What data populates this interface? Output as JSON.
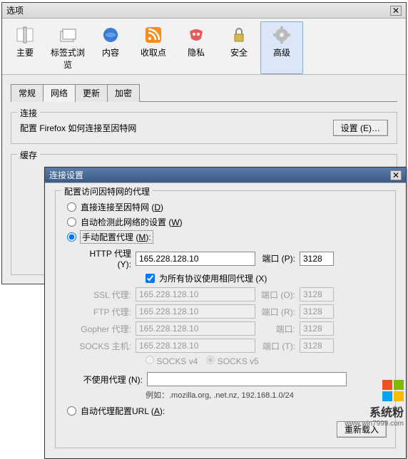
{
  "window": {
    "title": "选项",
    "toolbar": [
      {
        "label": "主要",
        "name": "main"
      },
      {
        "label": "标签式浏览",
        "name": "tabs"
      },
      {
        "label": "内容",
        "name": "content"
      },
      {
        "label": "收取点",
        "name": "feeds"
      },
      {
        "label": "隐私",
        "name": "privacy"
      },
      {
        "label": "安全",
        "name": "security"
      },
      {
        "label": "高级",
        "name": "advanced"
      }
    ],
    "tabs": [
      "常规",
      "网络",
      "更新",
      "加密"
    ],
    "connection": {
      "legend": "连接",
      "desc": "配置 Firefox 如何连接至因特网",
      "settings_btn": "设置 (E)…"
    },
    "cache": {
      "legend": "缓存"
    }
  },
  "dialog": {
    "title": "连接设置",
    "fieldset_legend": "配置访问因特网的代理",
    "radios": {
      "direct": "直接连接至因特网 (",
      "direct_u": "D",
      "auto_detect": "自动检测此网络的设置 (",
      "auto_detect_u": "W",
      "manual": "手动配置代理 (",
      "manual_u": "M",
      "auto_url": "自动代理配置URL (",
      "auto_url_u": "A",
      "close_paren": ")",
      "close_colon": "):"
    },
    "proxy": {
      "http_label": "HTTP 代理 (Y):",
      "ssl_label": "SSL 代理:",
      "ftp_label": "FTP 代理:",
      "gopher_label": "Gopher 代理:",
      "socks_label": "SOCKS 主机:",
      "host": "165.228.128.10",
      "port_label_p": "端口 (P):",
      "port_label_o": "端口 (O):",
      "port_label_r": "端口 (R):",
      "port_label_plain": "端口:",
      "port_label_t": "端口 (T):",
      "port": "3128",
      "share_chk": "为所有协议使用相同代理 (X)",
      "socks_v4": "SOCKS v4",
      "socks_v5": "SOCKS v5",
      "noproxy_label": "不使用代理 (N):",
      "noproxy_value": "",
      "example": "例如：.mozilla.org, .net.nz, 192.168.1.0/24",
      "reload_btn": "重新载入"
    }
  },
  "brand": {
    "name": "系统粉",
    "url": "www.win7999.com"
  }
}
